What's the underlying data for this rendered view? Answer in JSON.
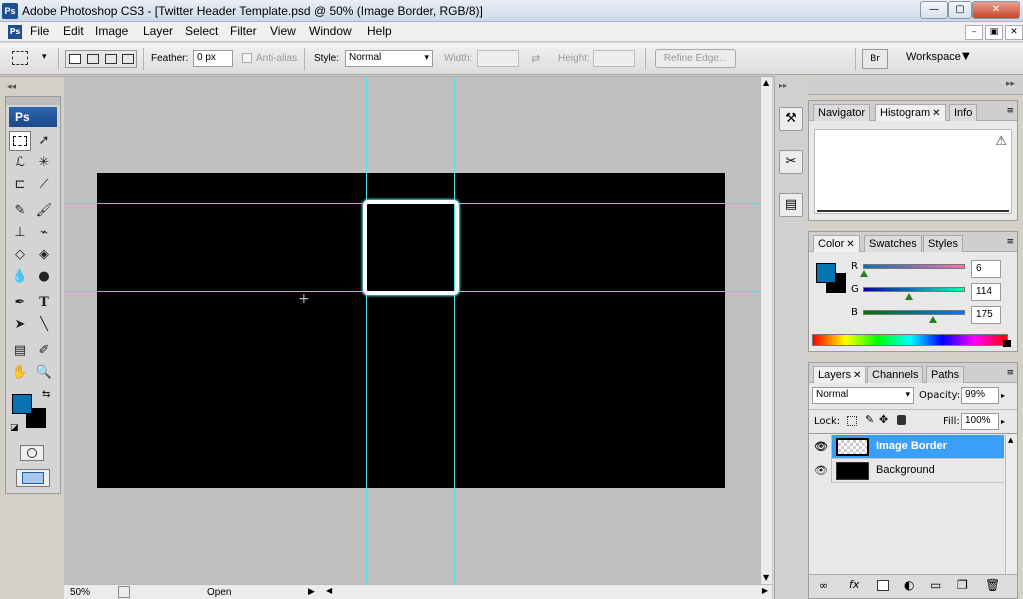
{
  "window": {
    "title": "Adobe Photoshop CS3 - [Twitter Header Template.psd @ 50% (Image Border, RGB/8)]",
    "app_badge": "Ps",
    "min_label": "—",
    "max_label": "▢",
    "close_label": "✕"
  },
  "menu": {
    "items": [
      "File",
      "Edit",
      "Image",
      "Layer",
      "Select",
      "Filter",
      "View",
      "Window",
      "Help"
    ],
    "doc_controls": [
      "–",
      "▣",
      "✕"
    ]
  },
  "options": {
    "feather_label": "Feather:",
    "feather_value": "0 px",
    "antialias_label": "Anti-alias",
    "style_label": "Style:",
    "style_value": "Normal",
    "width_label": "Width:",
    "height_label": "Height:",
    "refine_edge_label": "Refine Edge...",
    "workspace_label": "Workspace"
  },
  "toolbox": {
    "logo": "Ps"
  },
  "canvas": {
    "background": "#000000",
    "guide_color": "#4fdfe8",
    "frame_color": "#ffffff"
  },
  "status": {
    "zoom": "50%",
    "doc_info": "Open"
  },
  "navigator_panel": {
    "tabs": [
      "Navigator",
      "Histogram",
      "Info"
    ],
    "active_tab": "Histogram",
    "warning_icon": "⚠"
  },
  "color_panel": {
    "tabs": [
      "Color",
      "Swatches",
      "Styles"
    ],
    "active_tab": "Color",
    "fg_color": "#0672af",
    "bg_color": "#000000",
    "channels": [
      {
        "label": "R",
        "value": "6",
        "fraction": 0.024
      },
      {
        "label": "G",
        "value": "114",
        "fraction": 0.447
      },
      {
        "label": "B",
        "value": "175",
        "fraction": 0.686
      }
    ]
  },
  "layers_panel": {
    "tabs": [
      "Layers",
      "Channels",
      "Paths"
    ],
    "active_tab": "Layers",
    "blend_mode": "Normal",
    "opacity_label": "Opacity:",
    "opacity_value": "99%",
    "lock_label": "Lock:",
    "fill_label": "Fill:",
    "fill_value": "100%",
    "layers": [
      {
        "name": "Image Border",
        "selected": true
      },
      {
        "name": "Background",
        "selected": false
      }
    ]
  }
}
